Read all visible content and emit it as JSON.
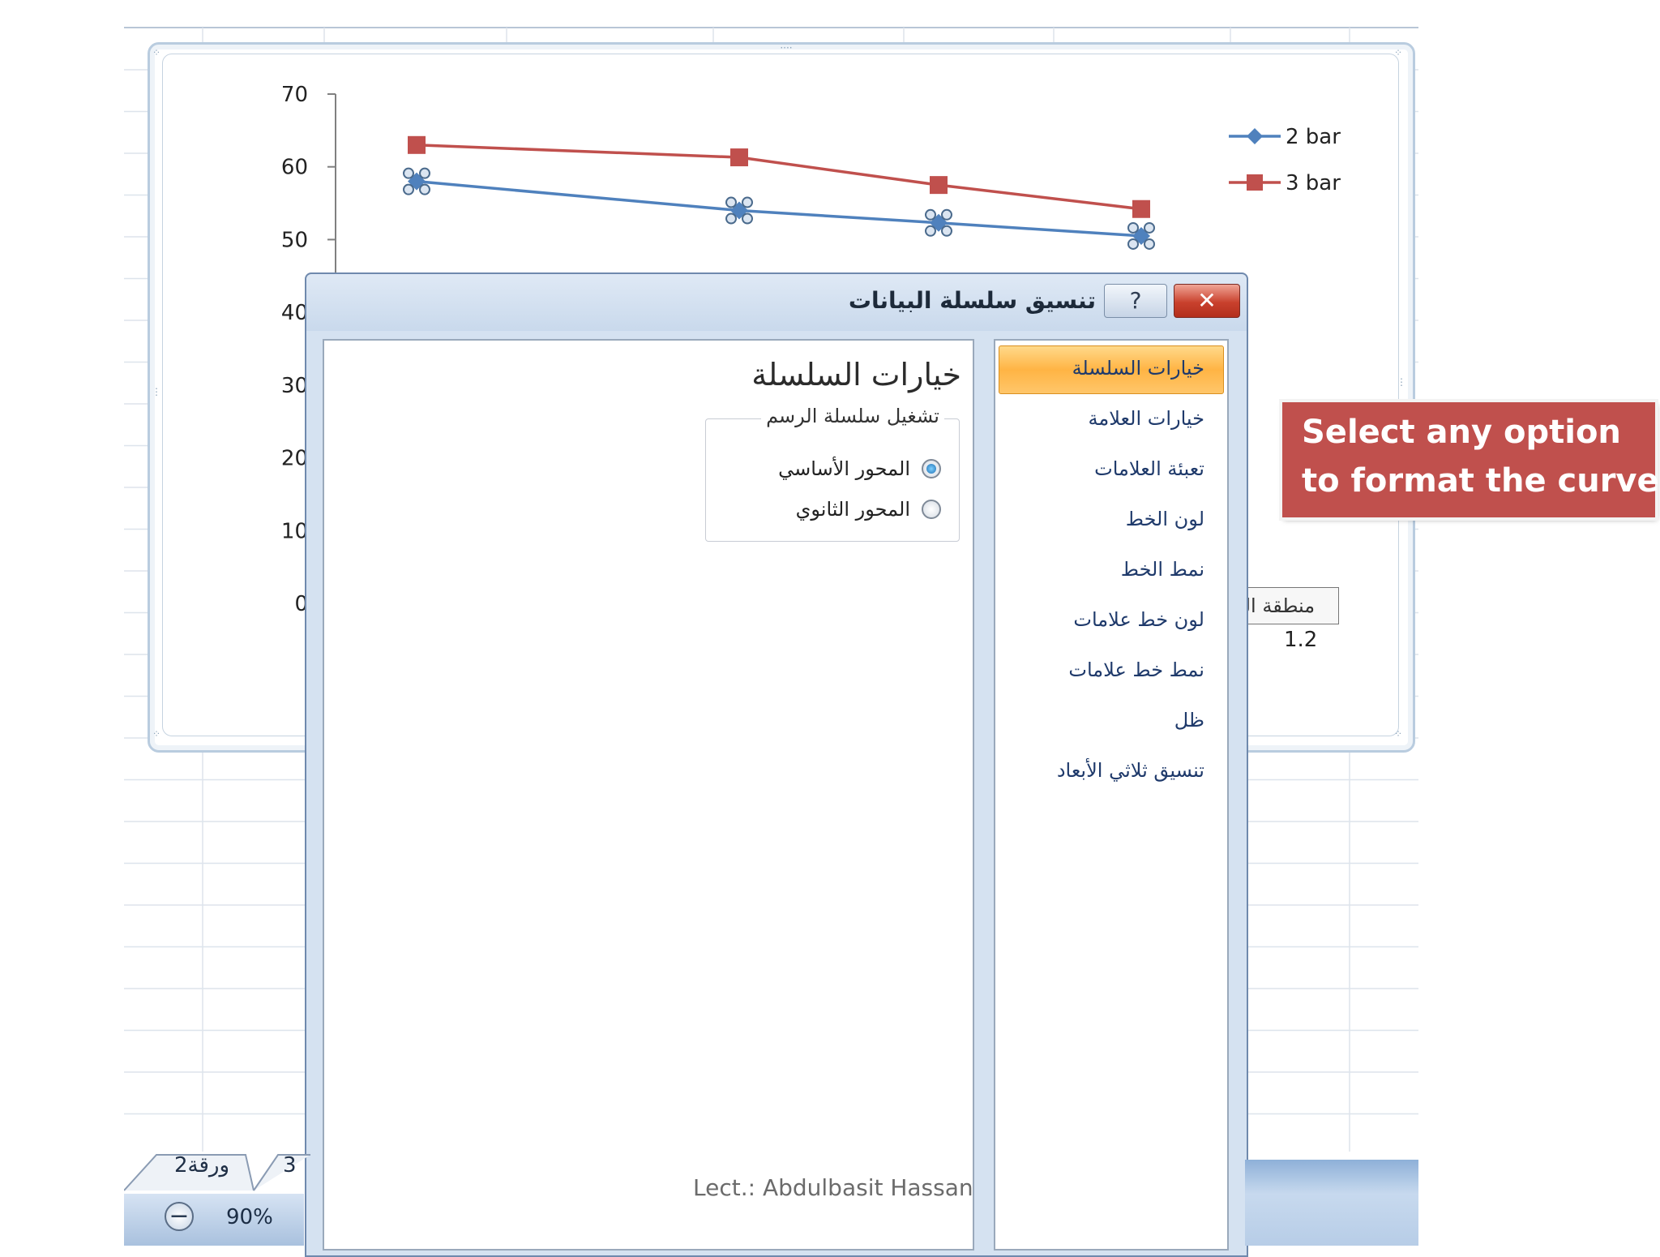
{
  "chart": {
    "y_ticks": [
      "70",
      "60",
      "50",
      "40",
      "30",
      "20",
      "10",
      "0"
    ],
    "legend": [
      {
        "name": "2 bar",
        "color": "#4f81bd",
        "marker": "diamond"
      },
      {
        "name": "3 bar",
        "color": "#c0504d",
        "marker": "square"
      }
    ],
    "value_label": "1.2"
  },
  "chart_data": {
    "type": "line",
    "ylim": [
      0,
      70
    ],
    "grid": false,
    "legend_position": "top-right",
    "series": [
      {
        "name": "2 bar",
        "values": [
          58,
          54,
          52.3,
          50.5
        ]
      },
      {
        "name": "3 bar",
        "values": [
          63,
          61.3,
          57.5,
          54.2
        ]
      }
    ]
  },
  "dialog": {
    "title": "تنسيق سلسلة البيانات",
    "help_label": "?",
    "close_label": "✕",
    "nav_items": [
      "خيارات السلسلة",
      "خيارات العلامة",
      "تعبئة العلامات",
      "لون الخط",
      "نمط الخط",
      "لون خط علامات",
      "نمط خط علامات",
      "ظل",
      "تنسيق ثلاثي الأبعاد"
    ],
    "section_title": "خيارات السلسلة",
    "group_title": "تشغيل سلسلة الرسم",
    "radio_primary": "المحور الأساسي",
    "radio_secondary": "المحور الثانوي",
    "primary_selected": true
  },
  "tooltip": "منطقة المخطط",
  "callout": {
    "line1": "Select any option",
    "line2": "to format the curve",
    "color": "#c0504d"
  },
  "watermark": "Lect.: Abdulbasit Hassan",
  "sheets": {
    "tab1": "ورقة2",
    "tab2": "3"
  },
  "zoom": {
    "level": "90%",
    "minus_label": "−"
  }
}
